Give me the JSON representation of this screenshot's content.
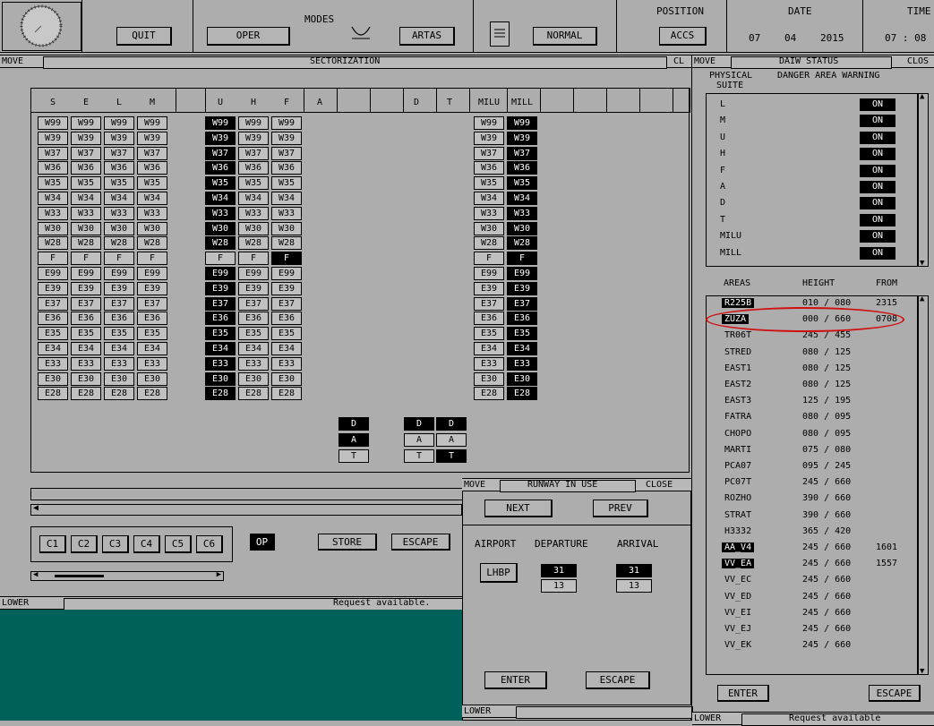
{
  "top": {
    "quit": "QUIT",
    "oper": "OPER",
    "modes_label": "MODES",
    "artas": "ARTAS",
    "normal": "NORMAL",
    "position_label": "POSITION",
    "position_value": "ACCS",
    "date_label": "DATE",
    "date_day": "07",
    "date_month": "04",
    "date_year": "2015",
    "time_label": "TIME",
    "time_value": "07 : 08"
  },
  "sector": {
    "title_left": "MOVE",
    "title": "SECTORIZATION",
    "close": "CL",
    "columns": [
      "S",
      "E",
      "L",
      "M",
      "U",
      "H",
      "F",
      "A",
      "D",
      "T",
      "MILU",
      "MILL"
    ],
    "rows": [
      "W99",
      "W39",
      "W37",
      "W36",
      "W35",
      "W34",
      "W33",
      "W30",
      "W28",
      "F",
      "E99",
      "E39",
      "E37",
      "E36",
      "E35",
      "E34",
      "E33",
      "E30",
      "E28"
    ],
    "dat": [
      "D",
      "A",
      "T"
    ],
    "configs": [
      "C1",
      "C2",
      "C3",
      "C4",
      "C5",
      "C6"
    ],
    "op": "OP",
    "store": "STORE",
    "escape": "ESCAPE"
  },
  "lower_left": {
    "label": "LOWER",
    "message": "Request available."
  },
  "runway": {
    "title_left": "MOVE",
    "title": "RUNWAY IN USE",
    "close": "CLOSE",
    "next": "NEXT",
    "prev": "PREV",
    "airport_label": "AIRPORT",
    "departure_label": "DEPARTURE",
    "arrival_label": "ARRIVAL",
    "airport": "LHBP",
    "dep_active": "31",
    "dep_other": "13",
    "arr_active": "31",
    "arr_other": "13",
    "enter": "ENTER",
    "escape": "ESCAPE",
    "lower": "LOWER"
  },
  "daiw": {
    "title_left": "MOVE",
    "title": "DAIW STATUS",
    "close": "CLOS",
    "physical_label": "PHYSICAL",
    "suite_label": "SUITE",
    "warning_label": "DANGER AREA WARNING",
    "suites": [
      {
        "name": "L",
        "state": "ON"
      },
      {
        "name": "M",
        "state": "ON"
      },
      {
        "name": "U",
        "state": "ON"
      },
      {
        "name": "H",
        "state": "ON"
      },
      {
        "name": "F",
        "state": "ON"
      },
      {
        "name": "A",
        "state": "ON"
      },
      {
        "name": "D",
        "state": "ON"
      },
      {
        "name": "T",
        "state": "ON"
      },
      {
        "name": "MILU",
        "state": "ON"
      },
      {
        "name": "MILL",
        "state": "ON"
      }
    ],
    "areas_label": "AREAS",
    "height_label": "HEIGHT",
    "from_label": "FROM",
    "areas": [
      {
        "name": "R225B",
        "height": "010 / 080",
        "from": "2315",
        "active": true
      },
      {
        "name": "ZUZA",
        "height": "000 / 660",
        "from": "0708",
        "active": true
      },
      {
        "name": "TR06T",
        "height": "245 / 455",
        "from": "",
        "active": false
      },
      {
        "name": "STRED",
        "height": "080 / 125",
        "from": "",
        "active": false
      },
      {
        "name": "EAST1",
        "height": "080 / 125",
        "from": "",
        "active": false
      },
      {
        "name": "EAST2",
        "height": "080 / 125",
        "from": "",
        "active": false
      },
      {
        "name": "EAST3",
        "height": "125 / 195",
        "from": "",
        "active": false
      },
      {
        "name": "FATRA",
        "height": "080 / 095",
        "from": "",
        "active": false
      },
      {
        "name": "CHOPO",
        "height": "080 / 095",
        "from": "",
        "active": false
      },
      {
        "name": "MARTI",
        "height": "075 / 080",
        "from": "",
        "active": false
      },
      {
        "name": "PCA07",
        "height": "095 / 245",
        "from": "",
        "active": false
      },
      {
        "name": "PC07T",
        "height": "245 / 660",
        "from": "",
        "active": false
      },
      {
        "name": "ROZHO",
        "height": "390 / 660",
        "from": "",
        "active": false
      },
      {
        "name": "STRAT",
        "height": "390 / 660",
        "from": "",
        "active": false
      },
      {
        "name": "H3332",
        "height": "365 / 420",
        "from": "",
        "active": false
      },
      {
        "name": "AA_V4",
        "height": "245 / 660",
        "from": "1601",
        "active": true
      },
      {
        "name": "VV_EA",
        "height": "245 / 660",
        "from": "1557",
        "active": true
      },
      {
        "name": "VV_EC",
        "height": "245 / 660",
        "from": "",
        "active": false
      },
      {
        "name": "VV_ED",
        "height": "245 / 660",
        "from": "",
        "active": false
      },
      {
        "name": "VV_EI",
        "height": "245 / 660",
        "from": "",
        "active": false
      },
      {
        "name": "VV_EJ",
        "height": "245 / 660",
        "from": "",
        "active": false
      },
      {
        "name": "VV_EK",
        "height": "245 / 660",
        "from": "",
        "active": false
      }
    ],
    "enter": "ENTER",
    "escape": "ESCAPE",
    "lower": "LOWER",
    "message": "Request available"
  },
  "colors": {
    "background": "#adadad",
    "lower_area": "#00605a",
    "highlight_ring": "#d01010"
  }
}
